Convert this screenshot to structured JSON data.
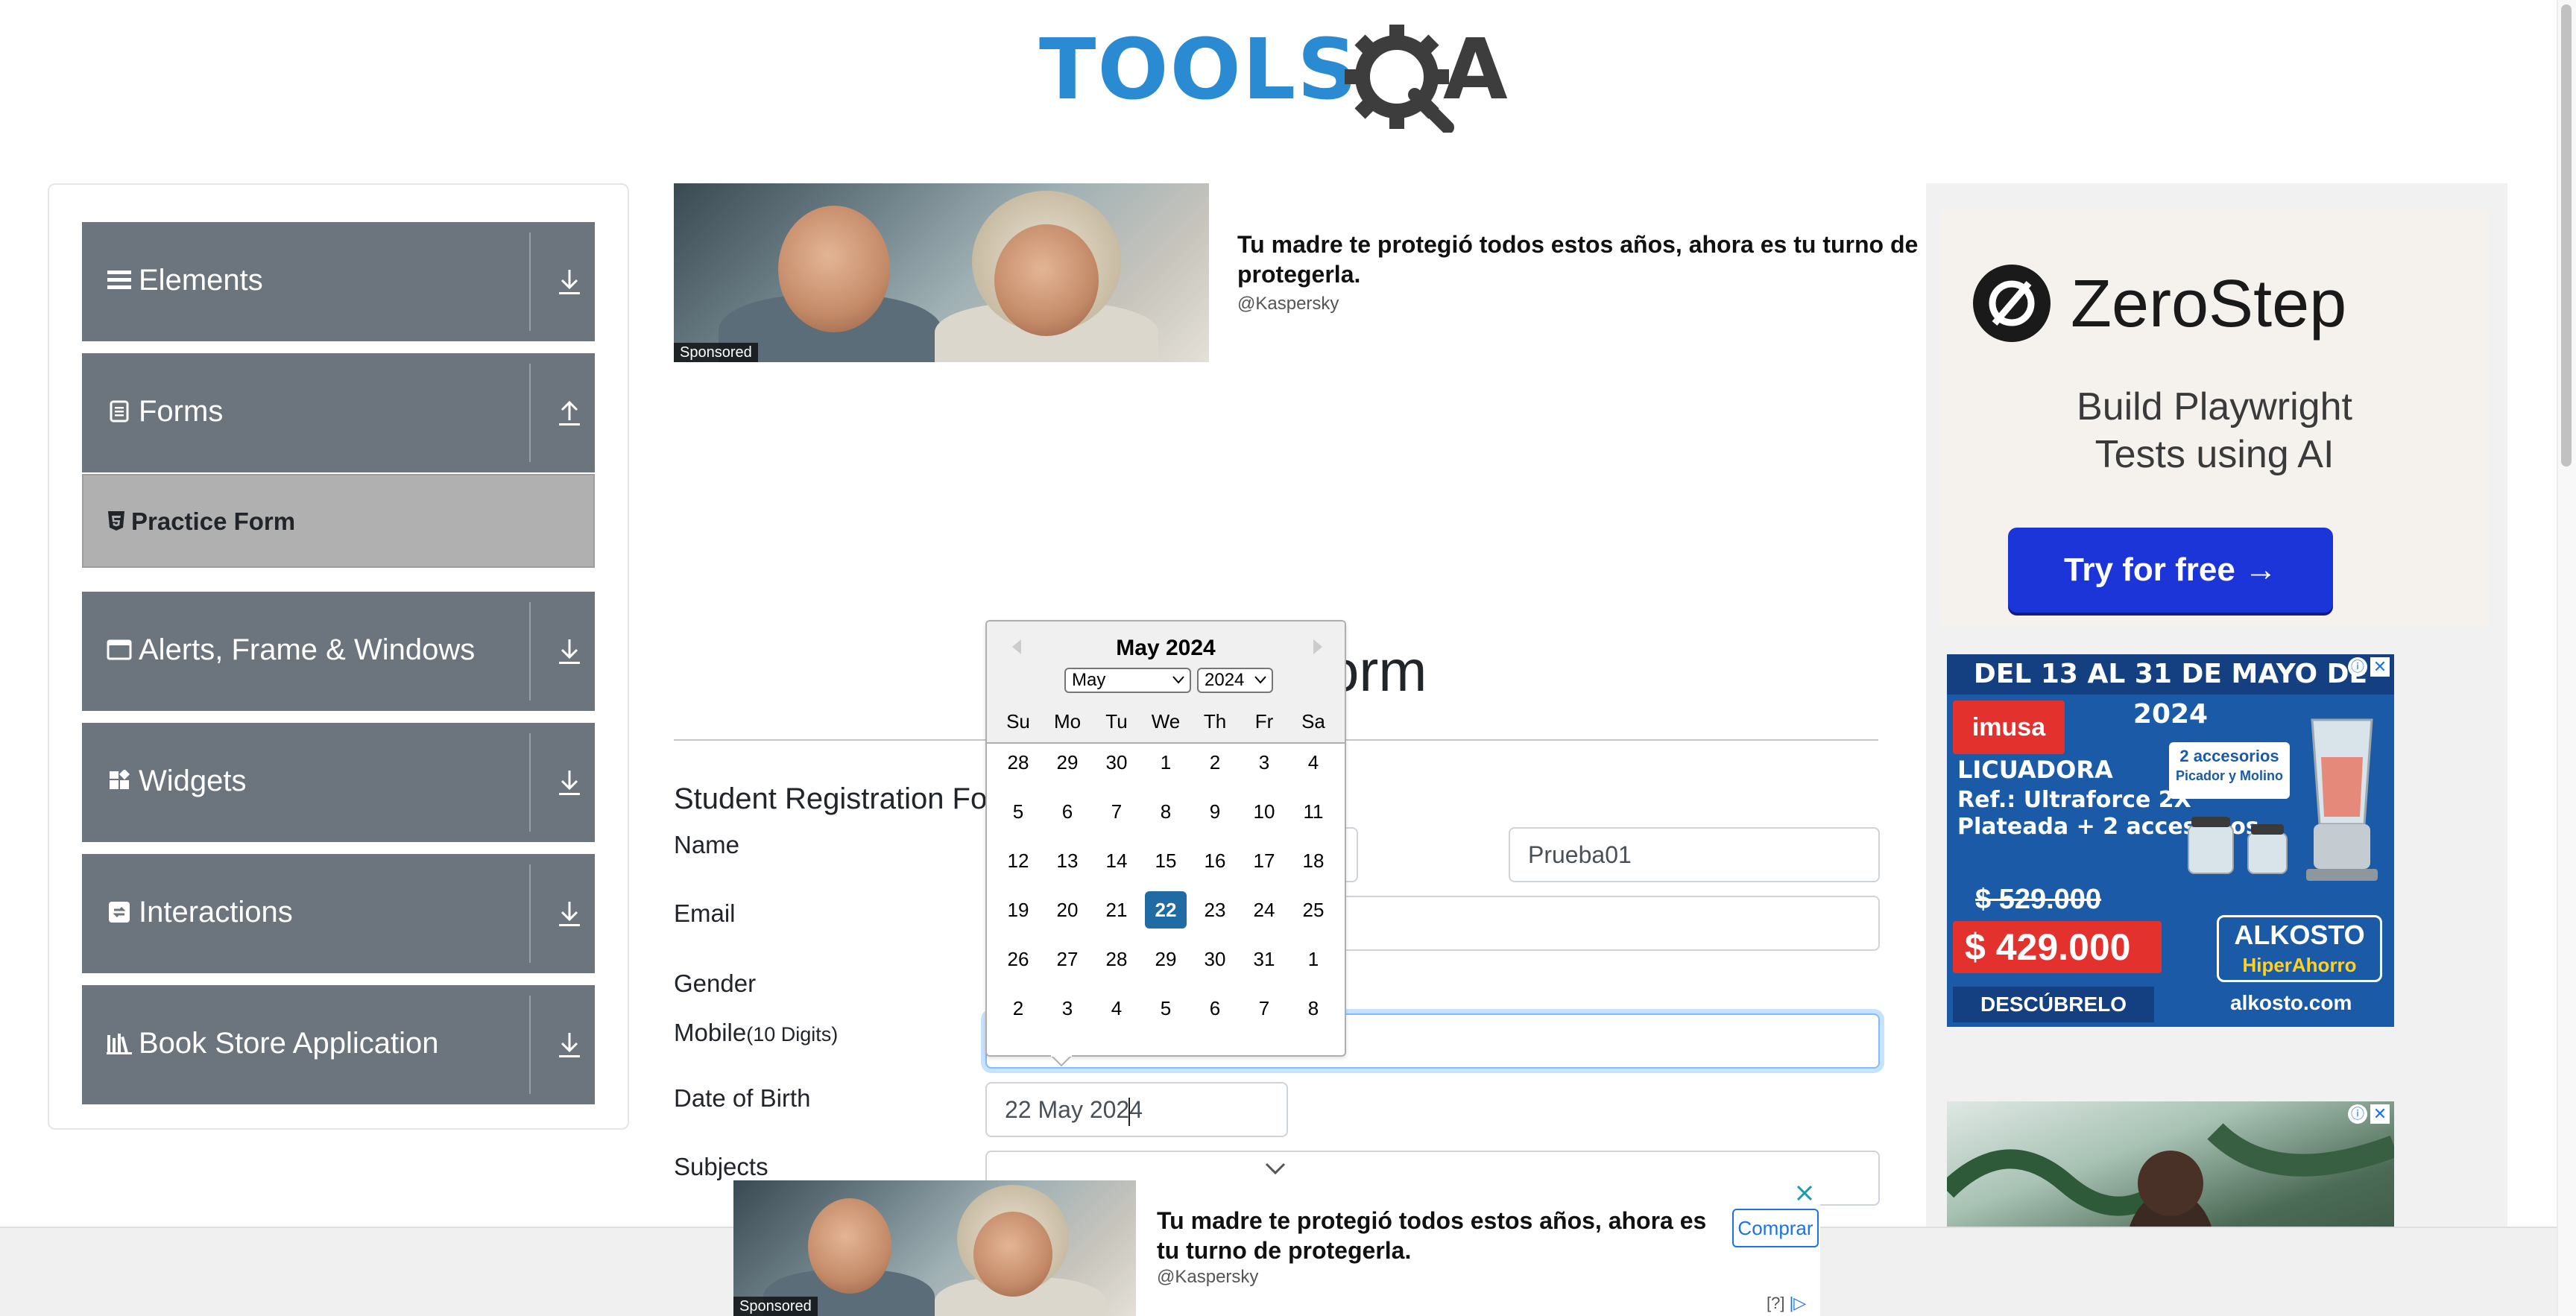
{
  "logo": {
    "text": "TOOLS",
    "text2": "A"
  },
  "sidebar": {
    "groups": [
      {
        "label": "Elements",
        "icon": "hamburger-icon",
        "arrow": "download-arrow-icon"
      },
      {
        "label": "Forms",
        "icon": "document-icon",
        "arrow": "upload-arrow-icon"
      },
      {
        "label": "Alerts, Frame & Windows",
        "icon": "window-icon",
        "arrow": "download-arrow-icon"
      },
      {
        "label": "Widgets",
        "icon": "widgets-icon",
        "arrow": "download-arrow-icon"
      },
      {
        "label": "Interactions",
        "icon": "interactions-icon",
        "arrow": "download-arrow-icon"
      },
      {
        "label": "Book Store Application",
        "icon": "books-icon",
        "arrow": "download-arrow-icon"
      }
    ],
    "active_item": {
      "label": "Practice Form",
      "icon": "html5-icon"
    }
  },
  "top_ad": {
    "headline": "Tu madre te protegió todos estos años, ahora es tu turno de protegerla.",
    "handle": "@Kaspersky",
    "sponsored": "Sponsored"
  },
  "page": {
    "title_visible": "orm"
  },
  "form": {
    "title": "Student Registration Fo",
    "labels": {
      "name": "Name",
      "email": "Email",
      "gender": "Gender",
      "mobile": "Mobile",
      "mobile_hint": "(10 Digits)",
      "dob": "Date of Birth",
      "subjects": "Subjects"
    },
    "last_name_value": "Prueba01",
    "dob_value_before_caret": "22 May 202",
    "dob_value_after_caret": "4"
  },
  "calendar": {
    "month_title": "May 2024",
    "month_select": "May",
    "year_select": "2024",
    "day_names": [
      "Su",
      "Mo",
      "Tu",
      "We",
      "Th",
      "Fr",
      "Sa"
    ],
    "weeks": [
      [
        "28",
        "29",
        "30",
        "1",
        "2",
        "3",
        "4"
      ],
      [
        "5",
        "6",
        "7",
        "8",
        "9",
        "10",
        "11"
      ],
      [
        "12",
        "13",
        "14",
        "15",
        "16",
        "17",
        "18"
      ],
      [
        "19",
        "20",
        "21",
        "22",
        "23",
        "24",
        "25"
      ],
      [
        "26",
        "27",
        "28",
        "29",
        "30",
        "31",
        "1"
      ],
      [
        "2",
        "3",
        "4",
        "5",
        "6",
        "7",
        "8"
      ]
    ],
    "selected_day": "22",
    "selected_color": "#216ba5"
  },
  "right_ads": {
    "zerostep": {
      "brand": "ZeroStep",
      "tagline_line1": "Build Playwright",
      "tagline_line2": "Tests using AI",
      "cta": "Try for free →"
    },
    "alkosto": {
      "banner": "DEL 13 AL 31 DE MAYO DE 2024",
      "brand_imusa": "imusa",
      "product": "LICUADORA",
      "ref": "Ref.: Ultraforce 2X",
      "desc": "Plateada + 2 accesorios.",
      "accessories_line1": "2 accesorios",
      "accessories_line2": "Picador y Molino",
      "old_price": "$ 529.000",
      "new_price": "$ 429.000",
      "store": "ALKOSTO",
      "store_sub": "HiperAhorro",
      "cta": "DESCÚBRELO AQUÍ",
      "url": "alkosto.com"
    }
  },
  "bottom_ad": {
    "headline": "Tu madre te protegió todos estos años, ahora es tu turno de protegerla.",
    "handle": "@Kaspersky",
    "buy": "Comprar",
    "sponsored": "Sponsored",
    "footer": "[?]"
  }
}
